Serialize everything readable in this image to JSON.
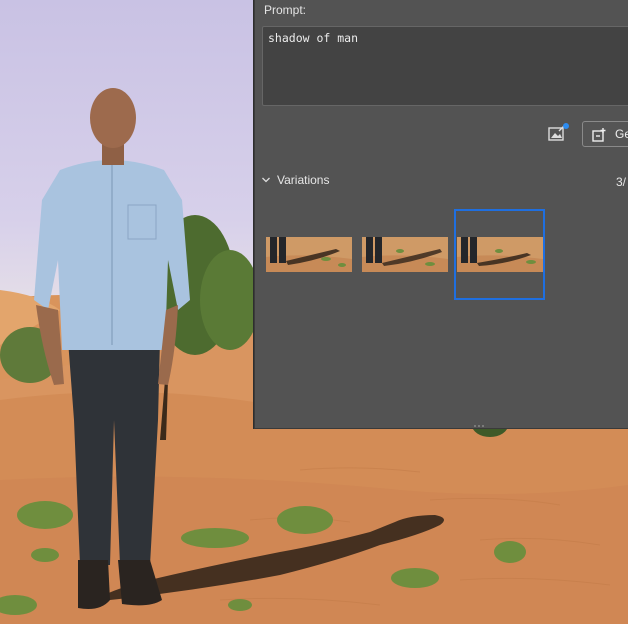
{
  "panel": {
    "prompt_label": "Prompt:",
    "prompt_value": "shadow of man",
    "generate_label": "Ge",
    "variations_label": "Variations",
    "variations_count": "3/",
    "selected_variation": 3,
    "accent_color": "#1f6fe0"
  },
  "icons": {
    "reference_image": "reference-image-icon",
    "generate": "generate-icon",
    "variations_toggle": "chevron-down-icon"
  }
}
